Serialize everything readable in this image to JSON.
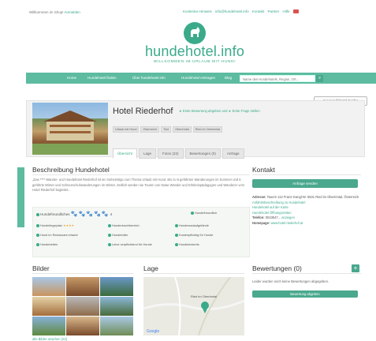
{
  "topbar": {
    "welcome_text": "Willkommen im Shop!",
    "login_link": "Anmelden",
    "links": [
      "Kostenlos Hinweis",
      "info@hundehotel.info",
      "Kontakt",
      "Partner",
      "Hilfe"
    ]
  },
  "brand": {
    "logo_text": "hundehotel.info",
    "tagline": "WILLKOMMEN IM URLAUB MIT HUND!",
    "accent_color": "#3aaa8a"
  },
  "nav": {
    "items": [
      "Home",
      "Hundehotel finden",
      "Über hundehotel.info",
      "Hundehotel eintragen",
      "Blog"
    ],
    "search_placeholder": "Name des Hundehotels, Region, Ort..."
  },
  "back_button": "zur Hundehotel Suche",
  "hotel": {
    "name": "Hotel Riederhof",
    "rating_text": "★ Erste Bewertung abgeben und ★ Erste Frage stellen",
    "tags": [
      "Urlaub mit Hund",
      "Österreich",
      "Tirol",
      "Oberinntal",
      "Ried im Oberinntal"
    ],
    "tabs": [
      "Übersicht",
      "Lage",
      "Fotos (22)",
      "Bewertungen (0)",
      "Anfrage"
    ]
  },
  "description": {
    "title": "Beschreibung Hundehotel",
    "text": "„Das **** Wander- und Hundehotel Riederhof ist ein Geheimtipp zum Thema Urlaub mit Hund. Bis zu 8 geführten Wanderungen im Sommer und 6 geführte Winter und Schneeschuhwanderungen im Winter. Zeitlich werden sie Touren von Natur Wander und Erlebnispädagogen und Wanderer vom Hotel Riederhof begleitet..."
  },
  "features": {
    "title": "Hundefreundliches",
    "paws": "4",
    "rows": [
      [
        "Hundefreundliches",
        "Hundefreundlich",
        "Hundeverwandt"
      ],
      [
        "Hundeliegeplatz",
        "Hundeduschbereich",
        "Hundeauslaufgelände"
      ],
      [
        "Hund im Restaurant erlaubt",
        "Hundefutter",
        "Kostenpflichtig für Hunde"
      ],
      [
        "Hundebetten",
        "Leine verpflichtend für Hunde",
        "Hundeleckerlis"
      ]
    ]
  },
  "kontakt": {
    "title": "Kontakt",
    "button": "Anfrage senden",
    "address_label": "Adresse:",
    "address": "Tauern 112 Franz-Gangl-W. 6531 Ried im Oberinntal, Österreich",
    "links": [
      "Anfahrtsbeschreibung zu Hundehotel",
      "Hundehotel auf der Karte",
      "Hundehotel Öffnungszeiten"
    ],
    "phone_label": "Telefon:",
    "phone": "0043547...",
    "phone_link": "anzeigen",
    "homepage_label": "Homepage:",
    "homepage": "www.hotel-riederhof.at"
  },
  "bilder": {
    "title": "Bilder",
    "more_link": "alle Bilder ansehen (22)"
  },
  "lage": {
    "title": "Lage",
    "map_label": "Ried im Oberinntal"
  },
  "bewertungen": {
    "title": "Bewertungen (0)",
    "empty_text": "Leider wurden noch keine Bewertungen abgegeben.",
    "button": "Bewertung abgeben"
  }
}
